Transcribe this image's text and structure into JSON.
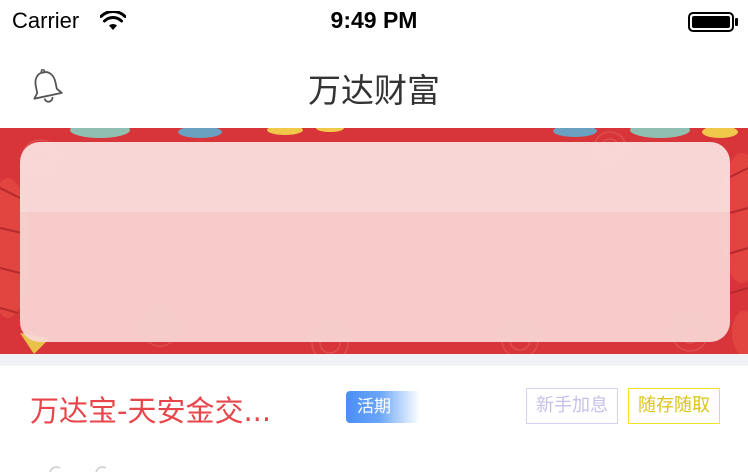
{
  "status_bar": {
    "carrier": "Carrier",
    "time": "9:49 PM",
    "wifi_icon": "wifi-icon",
    "battery_icon": "battery-icon"
  },
  "nav": {
    "title": "万达财富",
    "left_icon": "bell-icon"
  },
  "banner": {
    "background_color": "#d8353a",
    "card_color": "#f8d7d5"
  },
  "product": {
    "name": "万达宝-天安金交...",
    "tag_type": "活期",
    "tag_new_user": "新手加息",
    "tag_flexible": "随存随取",
    "name_color": "#e8454a",
    "tag_type_color": "#4a8ef6",
    "tag_new_user_color": "#c6c1ea",
    "tag_flexible_color": "#ddc41a"
  }
}
